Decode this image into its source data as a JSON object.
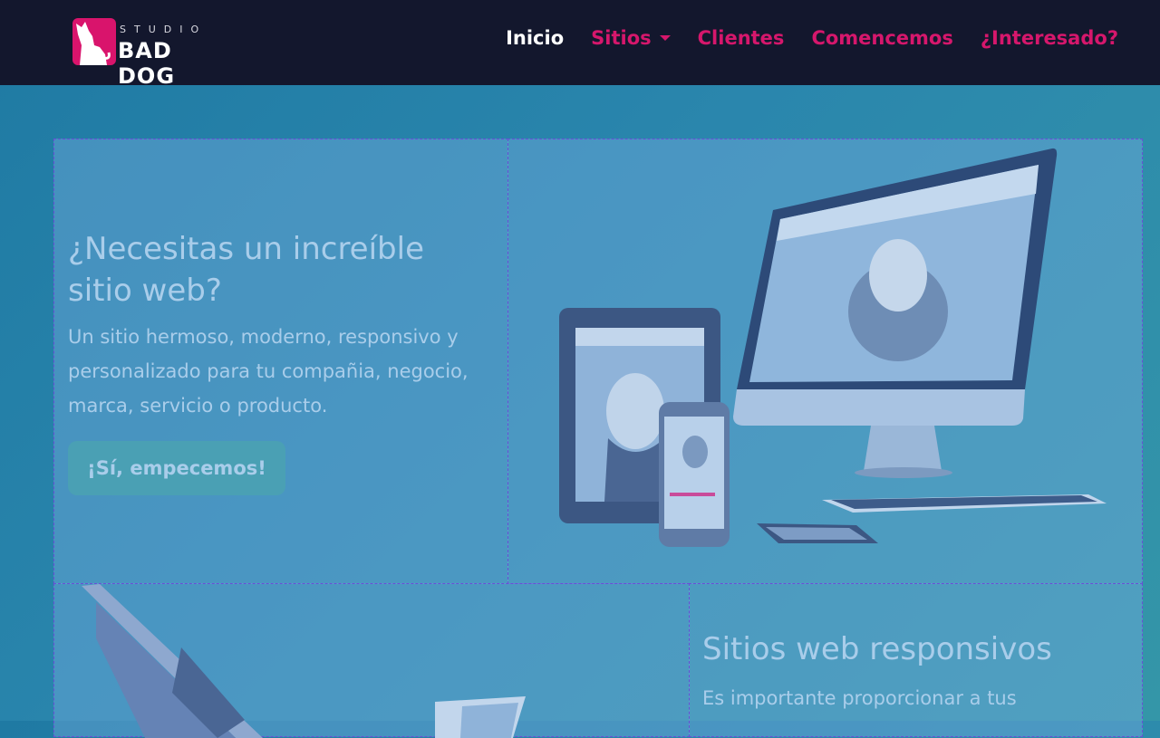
{
  "brand": {
    "studio": "STUDIO",
    "name": "BAD DOG"
  },
  "nav": {
    "items": [
      {
        "label": "Inicio"
      },
      {
        "label": "Sitios"
      },
      {
        "label": "Clientes"
      },
      {
        "label": "Comencemos"
      },
      {
        "label": "¿Interesado?"
      }
    ]
  },
  "hero": {
    "title": "¿Necesitas un increíble sitio web?",
    "text": "Un sitio hermoso, moderno, responsivo y personalizado para tu compañia, negocio, marca, servicio o producto.",
    "cta": "¡Sí, empecemos!"
  },
  "section2": {
    "title": "Sitios web responsivos",
    "text": "Es importante proporcionar a tus"
  },
  "colors": {
    "navbar": "#13172d",
    "accent": "#d6176c",
    "background": "#2a86ad",
    "text": "#a9cdea"
  },
  "icons": [
    "dog-logo-icon",
    "chevron-down-icon",
    "devices-image",
    "laptop-image"
  ]
}
